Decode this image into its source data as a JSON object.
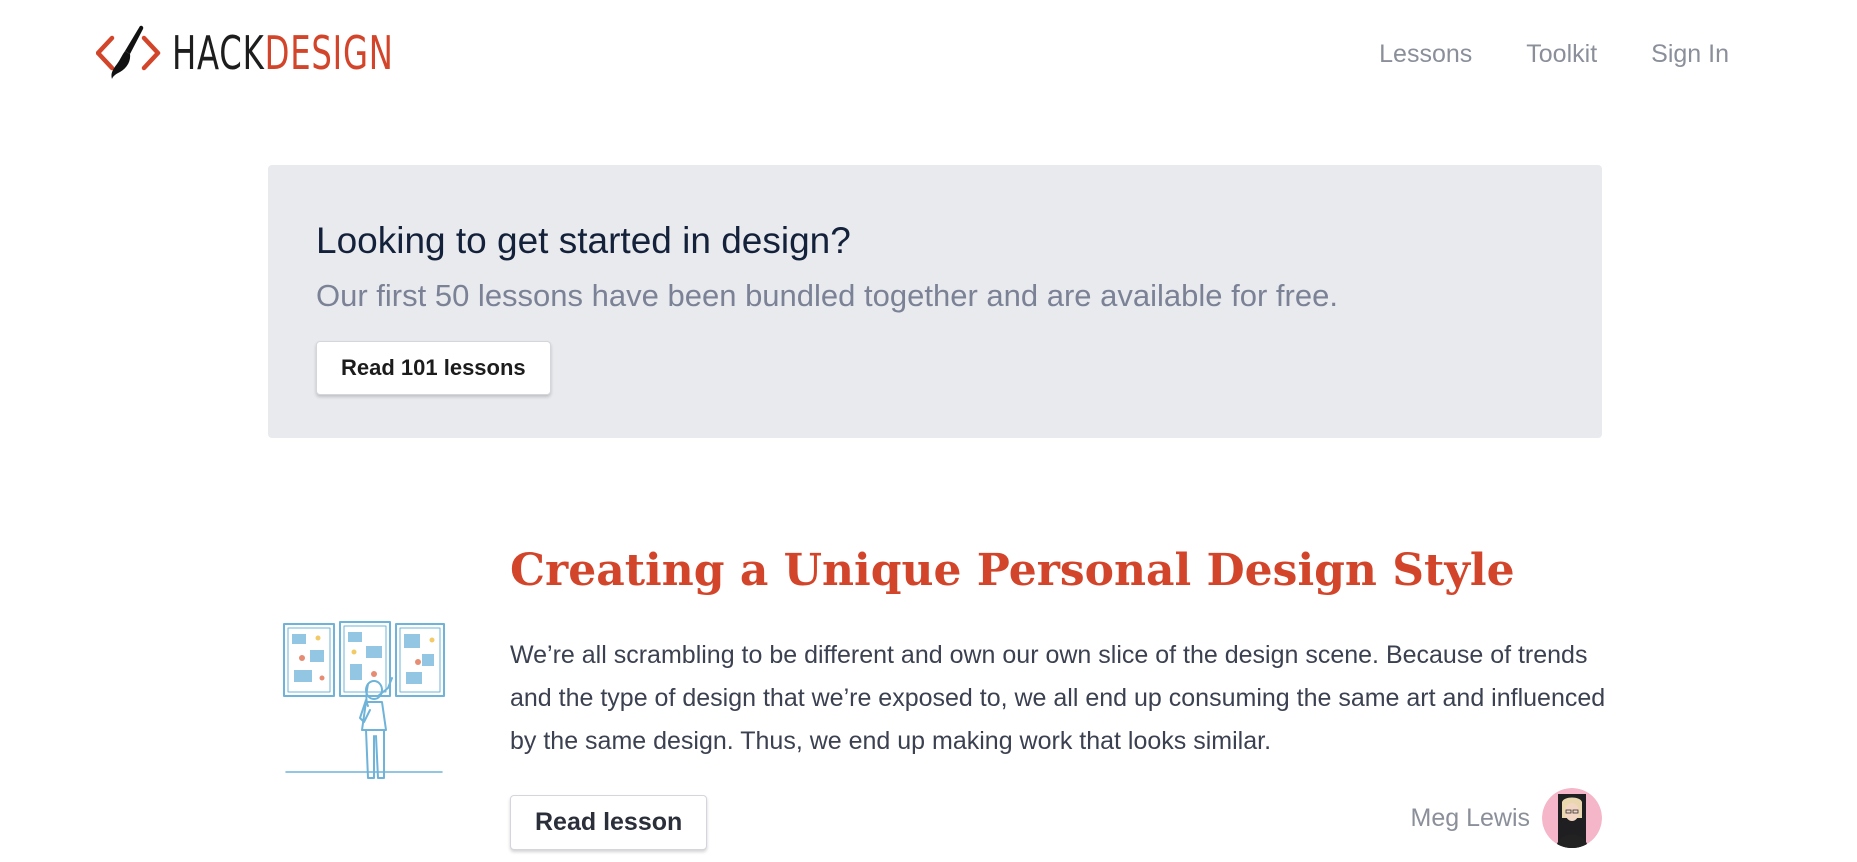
{
  "header": {
    "logo": {
      "part1": "HACK",
      "part2": "DESIGN",
      "icon": "code-brackets-paintbrush-icon"
    },
    "nav": [
      {
        "label": "Lessons"
      },
      {
        "label": "Toolkit"
      },
      {
        "label": "Sign In"
      }
    ]
  },
  "promo": {
    "title": "Looking to get started in design?",
    "subtitle": "Our first 50 lessons have been bundled together and are available for free.",
    "button_label": "Read 101 lessons"
  },
  "lesson": {
    "title": "Creating a Unique Personal Design Style",
    "description": "We’re all scrambling to be different and own our own slice of the design scene. Because of trends and the type of design that we’re exposed to, we all end up consuming the same art and influenced by the same design. Thus, we end up making work that looks similar.",
    "button_label": "Read lesson",
    "author": "Meg Lewis",
    "illustration": "person-looking-at-framed-art-illustration"
  },
  "colors": {
    "brand": "#d2452a",
    "banner_bg": "#e9eaee",
    "nav_text": "#8a8f9a",
    "heading": "#14213a",
    "illustration": "#6fb3d9"
  }
}
